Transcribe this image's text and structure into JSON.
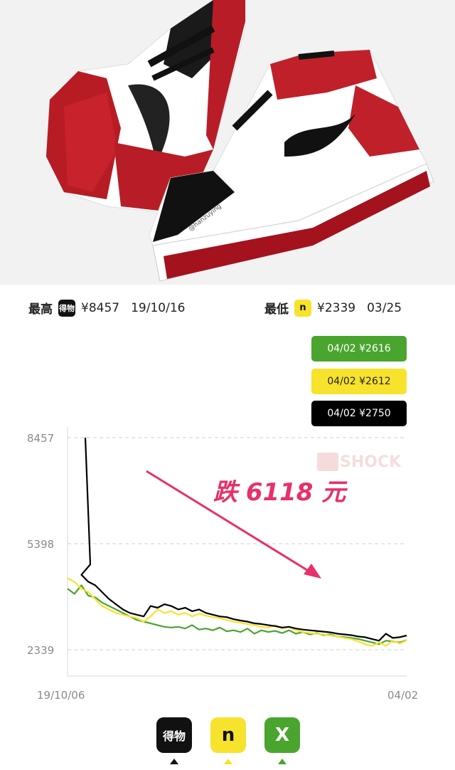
{
  "product_photo": {
    "watermark": "@hanzuying"
  },
  "stats": {
    "high": {
      "label": "最高",
      "app_icon": "dewu-icon",
      "price": "¥8457",
      "date": "19/10/16"
    },
    "low": {
      "label": "最低",
      "app_icon": "n-icon",
      "price": "¥2339",
      "date": "03/25"
    }
  },
  "legend": [
    {
      "text": "04/02 ¥2616",
      "bg": "#4aa52e",
      "fg": "#ffffff"
    },
    {
      "text": "04/02 ¥2612",
      "bg": "#f7e22c",
      "fg": "#222222"
    },
    {
      "text": "04/02 ¥2750",
      "bg": "#000000",
      "fg": "#ffffff"
    }
  ],
  "annotation": {
    "text": "跌 6118 元",
    "color": "#e8306a"
  },
  "watermark": {
    "text": "SHOCK"
  },
  "apps": [
    {
      "name": "得物",
      "icon": "dewu-icon",
      "bg": "#111111",
      "fg": "#ffffff",
      "caret": "#111111"
    },
    {
      "name": "n",
      "icon": "n-icon",
      "bg": "#f7e22c",
      "fg": "#111111",
      "caret": "#f7e22c"
    },
    {
      "name": "X",
      "icon": "x-icon",
      "bg": "#4aa52e",
      "fg": "#ffffff",
      "caret": "#4aa52e"
    }
  ],
  "chart_data": {
    "type": "line",
    "x_start": "19/10/06",
    "x_end": "04/02",
    "y_ticks": [
      8457,
      5398,
      2339
    ],
    "ylim": [
      2339,
      8457
    ],
    "grid": true,
    "series": [
      {
        "color": "#4aa52e",
        "values": [
          4100,
          3950,
          4200,
          3900,
          3850,
          3700,
          3600,
          3500,
          3400,
          3300,
          3200,
          3150,
          3100,
          3050,
          3000,
          2980,
          3000,
          2950,
          3050,
          2920,
          2950,
          2900,
          2980,
          2870,
          2900,
          2850,
          2950,
          2800,
          2900,
          2850,
          2880,
          2820,
          2900,
          2800,
          2850,
          2780,
          2820,
          2760,
          2780,
          2720,
          2700,
          2680,
          2650,
          2600,
          2550,
          2500,
          2600,
          2580,
          2550,
          2616
        ]
      },
      {
        "color": "#f7e22c",
        "values": [
          4400,
          4300,
          4100,
          4000,
          3800,
          3600,
          3500,
          3400,
          3350,
          3300,
          3250,
          3150,
          3300,
          3500,
          3400,
          3450,
          3350,
          3400,
          3300,
          3380,
          3320,
          3280,
          3250,
          3200,
          3150,
          3120,
          3080,
          3050,
          3000,
          2980,
          3050,
          2950,
          3000,
          2900,
          2850,
          2820,
          2800,
          2780,
          2750,
          2720,
          2680,
          2650,
          2580,
          2500,
          2450,
          2550,
          2450,
          2600,
          2520,
          2612
        ]
      },
      {
        "color": "#000000",
        "values": [
          8457,
          4800,
          4500,
          4300,
          4200,
          4000,
          3800,
          3650,
          3500,
          3400,
          3350,
          3300,
          3600,
          3550,
          3650,
          3600,
          3500,
          3550,
          3450,
          3500,
          3400,
          3350,
          3300,
          3280,
          3220,
          3180,
          3150,
          3100,
          3080,
          3050,
          3020,
          2980,
          3000,
          2950,
          2920,
          2900,
          2880,
          2860,
          2840,
          2800,
          2780,
          2760,
          2720,
          2700,
          2650,
          2600,
          2800,
          2680,
          2700,
          2750
        ]
      }
    ]
  }
}
